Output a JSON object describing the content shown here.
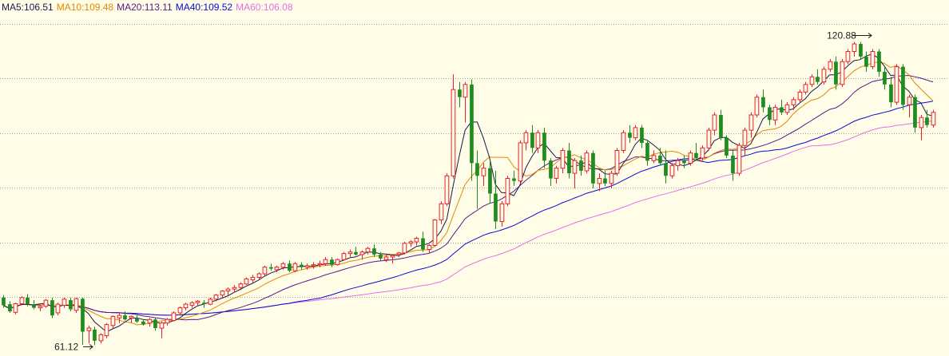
{
  "legend": {
    "ma5": {
      "label": "MA5:106.51",
      "color": "#1a1a4a"
    },
    "ma10": {
      "label": "MA10:109.48",
      "color": "#e08a00"
    },
    "ma20": {
      "label": "MA20:113.11",
      "color": "#551a8b"
    },
    "ma40": {
      "label": "MA40:109.52",
      "color": "#0a0ad0"
    },
    "ma60": {
      "label": "MA60:106.08",
      "color": "#e070e8"
    }
  },
  "annotations": {
    "high": "120.88",
    "low": "61.12"
  },
  "chart_data": {
    "type": "candlestick",
    "ylim": [
      59,
      126
    ],
    "grid": true,
    "legend_placement": "top-left",
    "colors": {
      "up": "#e8202a",
      "down": "#1e8c1e",
      "grid": "#a0a0a0",
      "background": "#fffde8"
    },
    "candles": [
      [
        70.5,
        71.0,
        68.5,
        69.0
      ],
      [
        69.2,
        69.8,
        67.5,
        67.8
      ],
      [
        67.6,
        69.5,
        67.2,
        69.3
      ],
      [
        69.3,
        70.8,
        69.0,
        70.5
      ],
      [
        70.5,
        71.2,
        68.8,
        69.2
      ],
      [
        69.0,
        70.0,
        68.2,
        68.5
      ],
      [
        68.5,
        69.0,
        67.8,
        68.8
      ],
      [
        68.8,
        70.2,
        68.5,
        70.0
      ],
      [
        70.0,
        70.5,
        66.5,
        67.0
      ],
      [
        67.5,
        69.5,
        67.0,
        69.2
      ],
      [
        69.0,
        70.5,
        68.5,
        70.2
      ],
      [
        70.0,
        70.5,
        67.8,
        68.2
      ],
      [
        68.0,
        70.5,
        67.5,
        70.3
      ],
      [
        70.3,
        70.5,
        61.2,
        63.8
      ],
      [
        64.0,
        65.0,
        61.5,
        64.5
      ],
      [
        64.2,
        64.8,
        61.12,
        62.0
      ],
      [
        62.0,
        63.5,
        61.5,
        63.2
      ],
      [
        63.0,
        65.5,
        62.5,
        65.2
      ],
      [
        65.0,
        67.0,
        64.5,
        66.8
      ],
      [
        66.5,
        67.5,
        65.5,
        67.0
      ],
      [
        67.0,
        67.8,
        66.0,
        66.2
      ],
      [
        66.5,
        67.0,
        65.5,
        66.8
      ],
      [
        66.5,
        67.0,
        65.5,
        65.8
      ],
      [
        65.8,
        66.2,
        65.0,
        65.2
      ],
      [
        65.5,
        66.5,
        64.8,
        66.2
      ],
      [
        66.2,
        66.5,
        64.0,
        64.5
      ],
      [
        64.5,
        65.8,
        62.5,
        65.5
      ],
      [
        65.5,
        66.5,
        65.0,
        66.2
      ],
      [
        66.0,
        67.8,
        65.8,
        67.5
      ],
      [
        67.5,
        68.8,
        67.0,
        68.5
      ],
      [
        68.5,
        69.5,
        68.0,
        69.2
      ],
      [
        69.0,
        69.8,
        68.5,
        69.5
      ],
      [
        69.5,
        70.0,
        68.8,
        69.8
      ],
      [
        69.5,
        70.0,
        68.5,
        69.2
      ],
      [
        69.2,
        70.5,
        69.0,
        70.2
      ],
      [
        70.2,
        71.2,
        69.8,
        71.0
      ],
      [
        71.0,
        72.0,
        70.5,
        71.8
      ],
      [
        71.8,
        72.5,
        71.0,
        72.2
      ],
      [
        72.2,
        73.0,
        71.5,
        72.5
      ],
      [
        72.5,
        73.5,
        72.0,
        73.2
      ],
      [
        73.2,
        74.5,
        73.0,
        74.2
      ],
      [
        74.0,
        75.0,
        73.5,
        74.5
      ],
      [
        74.5,
        75.5,
        74.0,
        75.2
      ],
      [
        75.2,
        76.8,
        74.8,
        76.5
      ],
      [
        76.5,
        77.2,
        75.8,
        76.2
      ],
      [
        76.0,
        76.8,
        75.5,
        76.5
      ],
      [
        76.5,
        77.5,
        76.0,
        77.2
      ],
      [
        77.2,
        77.8,
        75.5,
        75.8
      ],
      [
        75.8,
        77.5,
        75.5,
        77.2
      ],
      [
        77.0,
        77.5,
        76.0,
        76.5
      ],
      [
        76.5,
        77.2,
        76.0,
        76.8
      ],
      [
        76.8,
        77.5,
        76.2,
        77.0
      ],
      [
        77.0,
        77.8,
        76.5,
        77.2
      ],
      [
        77.2,
        78.5,
        76.8,
        78.0
      ],
      [
        78.0,
        78.5,
        76.5,
        77.0
      ],
      [
        77.0,
        78.2,
        76.8,
        78.0
      ],
      [
        78.0,
        79.5,
        77.8,
        79.2
      ],
      [
        79.2,
        80.0,
        78.5,
        79.5
      ],
      [
        79.5,
        80.5,
        78.8,
        79.0
      ],
      [
        79.0,
        79.8,
        78.0,
        79.5
      ],
      [
        79.5,
        80.5,
        79.0,
        80.2
      ],
      [
        80.2,
        81.0,
        78.5,
        79.0
      ],
      [
        79.0,
        79.5,
        77.8,
        78.2
      ],
      [
        78.0,
        79.0,
        77.5,
        78.5
      ],
      [
        78.5,
        79.0,
        77.2,
        78.8
      ],
      [
        79.0,
        79.5,
        78.5,
        79.3
      ],
      [
        79.3,
        81.5,
        79.0,
        81.2
      ],
      [
        81.2,
        81.8,
        80.5,
        81.5
      ],
      [
        81.5,
        82.5,
        80.8,
        82.2
      ],
      [
        82.2,
        83.5,
        79.5,
        80.0
      ],
      [
        80.0,
        81.0,
        79.2,
        80.8
      ],
      [
        80.8,
        86.0,
        80.5,
        85.8
      ],
      [
        85.8,
        89.5,
        85.0,
        89.0
      ],
      [
        89.0,
        95.0,
        88.5,
        94.5
      ],
      [
        94.5,
        114.5,
        94.0,
        111.5
      ],
      [
        111.5,
        113.0,
        108.0,
        110.0
      ],
      [
        110.0,
        113.0,
        105.0,
        112.5
      ],
      [
        112.5,
        113.5,
        93.5,
        97.0
      ],
      [
        97.0,
        99.5,
        88.0,
        94.5
      ],
      [
        94.5,
        97.0,
        92.5,
        96.0
      ],
      [
        96.0,
        97.5,
        89.0,
        91.0
      ],
      [
        91.0,
        95.5,
        84.0,
        85.5
      ],
      [
        85.5,
        89.5,
        84.5,
        89.0
      ],
      [
        89.0,
        94.5,
        88.5,
        94.0
      ],
      [
        94.0,
        95.5,
        92.5,
        93.5
      ],
      [
        93.5,
        101.5,
        93.0,
        101.0
      ],
      [
        101.0,
        103.5,
        99.5,
        103.0
      ],
      [
        103.0,
        104.5,
        99.0,
        100.0
      ],
      [
        100.0,
        103.5,
        99.0,
        103.0
      ],
      [
        103.0,
        104.0,
        96.0,
        97.5
      ],
      [
        97.5,
        98.0,
        92.5,
        94.0
      ],
      [
        94.0,
        96.5,
        93.0,
        96.0
      ],
      [
        96.0,
        100.0,
        95.0,
        99.5
      ],
      [
        99.5,
        101.0,
        94.0,
        95.0
      ],
      [
        95.0,
        98.0,
        92.0,
        97.5
      ],
      [
        97.5,
        98.5,
        94.5,
        95.5
      ],
      [
        95.5,
        99.5,
        95.0,
        99.0
      ],
      [
        99.0,
        99.5,
        92.0,
        93.0
      ],
      [
        93.0,
        95.0,
        91.5,
        94.0
      ],
      [
        94.0,
        95.5,
        92.5,
        93.0
      ],
      [
        93.0,
        95.5,
        92.0,
        95.0
      ],
      [
        95.0,
        100.0,
        94.5,
        99.5
      ],
      [
        99.5,
        103.5,
        99.0,
        103.0
      ],
      [
        103.0,
        104.5,
        101.0,
        102.0
      ],
      [
        102.0,
        104.5,
        101.5,
        104.0
      ],
      [
        104.0,
        104.5,
        100.0,
        101.0
      ],
      [
        101.0,
        101.5,
        96.5,
        97.5
      ],
      [
        97.5,
        99.5,
        97.0,
        98.5
      ],
      [
        98.5,
        100.0,
        96.5,
        97.0
      ],
      [
        97.0,
        99.5,
        93.0,
        94.5
      ],
      [
        94.5,
        97.0,
        94.0,
        96.5
      ],
      [
        96.5,
        98.0,
        95.5,
        97.5
      ],
      [
        97.5,
        98.5,
        96.0,
        97.0
      ],
      [
        97.0,
        99.5,
        96.5,
        99.0
      ],
      [
        99.0,
        101.0,
        97.5,
        98.0
      ],
      [
        98.0,
        100.5,
        97.5,
        100.0
      ],
      [
        100.0,
        104.0,
        99.5,
        103.5
      ],
      [
        103.5,
        107.0,
        102.5,
        106.5
      ],
      [
        106.5,
        107.5,
        101.5,
        102.0
      ],
      [
        102.0,
        102.5,
        98.0,
        98.5
      ],
      [
        98.5,
        99.5,
        93.5,
        95.0
      ],
      [
        95.0,
        101.0,
        94.5,
        100.5
      ],
      [
        100.5,
        104.0,
        98.5,
        103.5
      ],
      [
        103.5,
        107.0,
        102.0,
        106.5
      ],
      [
        106.5,
        110.5,
        106.0,
        110.0
      ],
      [
        110.0,
        111.5,
        107.0,
        108.0
      ],
      [
        108.0,
        108.5,
        104.5,
        105.5
      ],
      [
        105.5,
        108.5,
        104.5,
        108.0
      ],
      [
        108.0,
        109.5,
        106.5,
        107.0
      ],
      [
        107.0,
        109.0,
        106.5,
        108.5
      ],
      [
        108.5,
        110.0,
        107.5,
        109.5
      ],
      [
        109.5,
        111.5,
        109.0,
        111.0
      ],
      [
        111.0,
        113.0,
        110.5,
        112.5
      ],
      [
        112.5,
        114.5,
        112.0,
        114.0
      ],
      [
        114.0,
        115.5,
        112.5,
        113.0
      ],
      [
        113.0,
        116.0,
        112.5,
        115.5
      ],
      [
        115.5,
        117.5,
        115.0,
        117.0
      ],
      [
        117.0,
        118.0,
        111.5,
        112.5
      ],
      [
        112.5,
        117.5,
        112.0,
        117.0
      ],
      [
        117.0,
        119.5,
        116.5,
        119.0
      ],
      [
        119.0,
        120.88,
        118.0,
        120.5
      ],
      [
        120.5,
        120.88,
        117.5,
        118.0
      ],
      [
        118.0,
        119.0,
        115.0,
        116.0
      ],
      [
        116.0,
        119.5,
        115.5,
        119.0
      ],
      [
        119.0,
        119.5,
        114.0,
        115.0
      ],
      [
        115.0,
        116.0,
        111.5,
        112.5
      ],
      [
        112.5,
        114.0,
        108.0,
        109.0
      ],
      [
        109.0,
        116.5,
        108.5,
        116.0
      ],
      [
        116.0,
        116.5,
        107.5,
        108.5
      ],
      [
        108.5,
        110.5,
        106.0,
        110.0
      ],
      [
        110.0,
        110.5,
        103.0,
        104.0
      ],
      [
        104.0,
        106.5,
        101.5,
        106.0
      ],
      [
        106.0,
        107.5,
        104.0,
        104.5
      ],
      [
        104.5,
        107.5,
        104.0,
        107.0
      ]
    ]
  }
}
